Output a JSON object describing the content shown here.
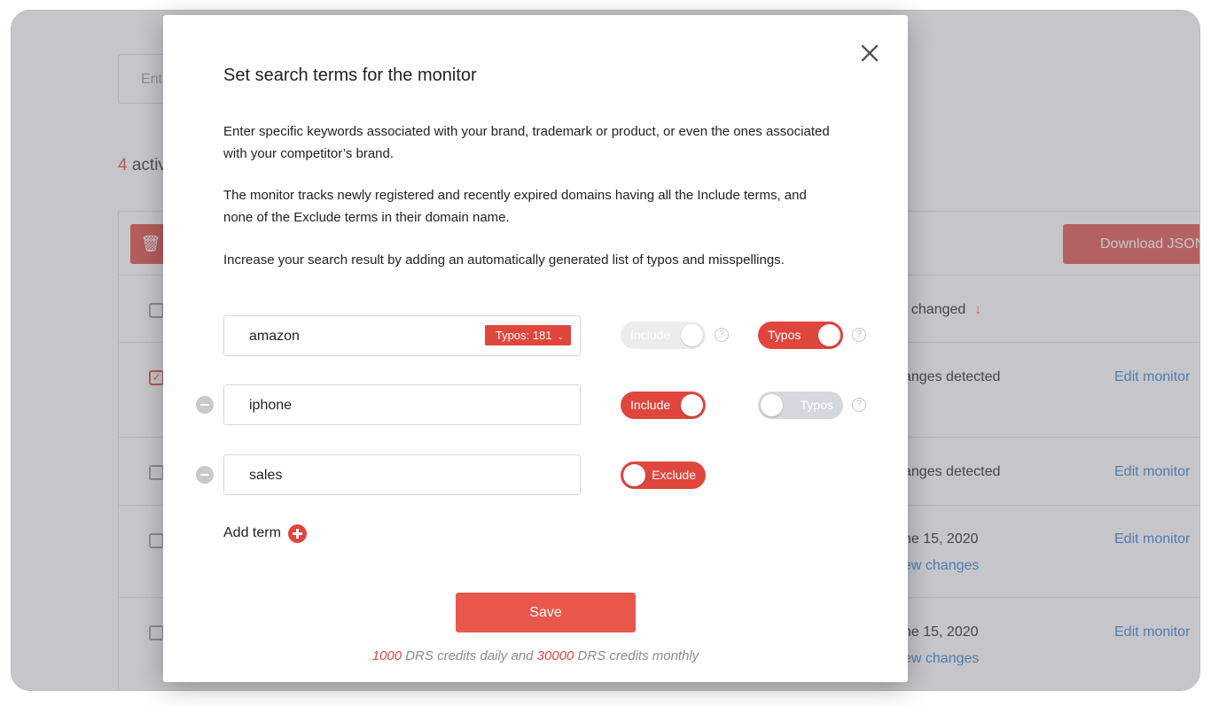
{
  "background": {
    "search_placeholder": "Ente",
    "count_number": "4",
    "count_label": "activ",
    "download_label": "Download JSON",
    "sort_column": "t changed",
    "rows": [
      {
        "status": "anges detected",
        "action": "Edit monitor",
        "checked": true
      },
      {
        "status": "anges detected",
        "action": "Edit monitor",
        "checked": false
      },
      {
        "status": "ne 15, 2020",
        "link": "ew changes",
        "action": "Edit monitor",
        "checked": false
      },
      {
        "status": "ne 15, 2020",
        "link": "ew changes",
        "action": "Edit monitor",
        "checked": false
      }
    ]
  },
  "modal": {
    "title": "Set search terms for the monitor",
    "paragraphs": [
      "Enter specific keywords associated with your brand, trademark or product, or even the ones associated with your competitor’s brand.",
      "The monitor tracks newly registered and recently expired domains having all the Include terms, and none of the Exclude terms in their domain name.",
      "Increase your search result by adding an automatically generated list of typos and misspellings."
    ],
    "terms": [
      {
        "value": "amazon",
        "typos_chip": "Typos: 181",
        "mode_label": "Include",
        "typos_label": "Typos"
      },
      {
        "value": "iphone",
        "mode_label": "Include",
        "typos_label": "Typos"
      },
      {
        "value": "sales",
        "mode_label": "Exclude"
      }
    ],
    "add_term_label": "Add term",
    "save_label": "Save",
    "credits": {
      "daily": "1000",
      "daily_text": " DRS credits daily and ",
      "monthly": "30000",
      "monthly_text": " DRS credits monthly"
    }
  }
}
